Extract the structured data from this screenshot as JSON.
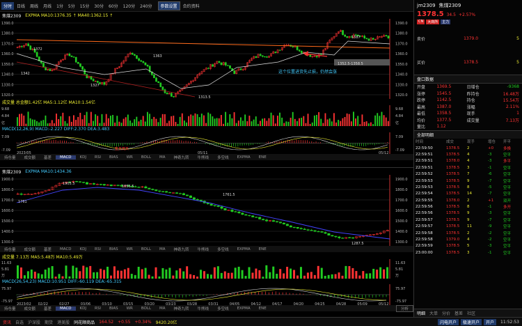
{
  "toolbar": {
    "items": [
      "分时",
      "日线",
      "周线",
      "月线",
      "1分",
      "5分",
      "15分",
      "30分",
      "60分",
      "120分",
      "240分"
    ],
    "active_index": 0,
    "params_button": "参数设置",
    "contract_info": "合约资料"
  },
  "upper_chart": {
    "symbol": "焦煤2309",
    "indicator_line": "EXPMA MA10:1376.35 ↑ MA40:1362.15 ↑",
    "y_ticks": [
      "1390.0",
      "1380.0",
      "1370.0",
      "1360.0",
      "1350.0",
      "1340.0",
      "1330.0",
      "1320.0"
    ],
    "labels": {
      "high": "1387",
      "p1372": "1372",
      "p1363": "1363",
      "p1342": "1342",
      "p1327": "1327",
      "low": "1313.5",
      "p1352": "1352.5-1358.5"
    },
    "annotation": "这个位置进货先止损，仍然会涨",
    "volume_line": "成交量 总金额1.42亿  MA5:1.12亿  MA10:1.54亿",
    "vol_ticks": [
      "9.68",
      "4.84",
      "亿"
    ],
    "macd_line": "MACD(12,26,9)  MACD:-2.227  DIFF:2.370  DEA:3.483",
    "macd_ticks": [
      "7.09",
      "-7.09"
    ],
    "macd_mark": "金叉死叉",
    "x_labels": [
      "2023/05",
      "05/11",
      "05/12"
    ],
    "tabs": [
      "持仓量",
      "成交额",
      "基差",
      "MACD",
      "KDJ",
      "RSI",
      "BIAS",
      "WR",
      "BOLL",
      "MA",
      "神奇九转",
      "牛熊线",
      "多空线",
      "EXPMA",
      "ENE"
    ],
    "active_tab": "MACD"
  },
  "lower_chart": {
    "symbol": "焦煤2309",
    "indicator_line": "EXPMA MA10:1434.36",
    "y_ticks": [
      "1900.0",
      "1800.0",
      "1700.0",
      "1600.0",
      "1500.0",
      "1400.0",
      "1300.0"
    ],
    "labels": {
      "high": "1905.5",
      "p1856": "1856.5",
      "p1761": "1761.5",
      "p1761b": "1761",
      "low": "1287.5"
    },
    "volume_line": "成交量 7.13万  MA5:5.48万  MA10:5.49万",
    "vol_ticks": [
      "11.63",
      "5.81",
      "万"
    ],
    "macd_line": "MACD(26,54,23)  MACD:10.951  DIFF:-60.119  DEA:-65.315",
    "macd_ticks": [
      "75.97",
      "-75.97"
    ],
    "x_labels": [
      "2023/02",
      "02/22",
      "02/27",
      "03/06",
      "03/10",
      "03/15",
      "03/20",
      "03/23",
      "03/28",
      "03/31",
      "04/05",
      "04/12",
      "04/17",
      "04/20",
      "04/25",
      "04/28",
      "05/09",
      "05/12"
    ],
    "tabs": [
      "持仓量",
      "成交额",
      "基差",
      "MACD",
      "KDJ",
      "RSI",
      "BIAS",
      "WR",
      "BOLL",
      "MA",
      "神奇九转",
      "牛熊线",
      "多空线",
      "EXPMA",
      "ENE"
    ],
    "active_tab": "MACD",
    "analysis_button": "分析"
  },
  "quote": {
    "code": "jm2309",
    "name": "焦煤2309",
    "price": "1378.5",
    "change": "34.5",
    "pct": "+2.57%",
    "tags": [
      "CN",
      "大商所",
      "主力"
    ],
    "ask_label": "卖价",
    "ask_price": "1379.0",
    "ask_vol": "5",
    "bid_label": "买价",
    "bid_price": "1378.5",
    "bid_vol": "5",
    "section": "盘口数据",
    "stats": [
      {
        "k1": "开盘",
        "v1": "1369.5",
        "k2": "日增仓",
        "v2": "-9368"
      },
      {
        "k1": "涨停",
        "v1": "1545.5",
        "k2": "昨持仓",
        "v2": "16.48万"
      },
      {
        "k1": "跌停",
        "v1": "1142.5",
        "k2": "持仓",
        "v2": "15.54万"
      },
      {
        "k1": "最高",
        "v1": "1387.0",
        "k2": "涨幅",
        "v2": "2.11%"
      },
      {
        "k1": "最低",
        "v1": "1358.5",
        "k2": "现手",
        "v2": "1"
      },
      {
        "k1": "均价",
        "v1": "1377.5",
        "k2": "成交量",
        "v2": "7.13万"
      },
      {
        "k1": "量比",
        "v1": "1.12",
        "k2": "",
        "v2": ""
      }
    ],
    "trade_tabs": [
      "全部明细"
    ],
    "trade_headers": [
      "时间",
      "成交",
      "现手",
      "增仓",
      "开平"
    ],
    "trades": [
      [
        "22:59:50",
        "1378.5",
        "2",
        "+0",
        "多换"
      ],
      [
        "22:59:51",
        "1378.5",
        "4",
        "-3",
        "空平"
      ],
      [
        "22:59:51",
        "1378.0",
        "4",
        "-3",
        "多平"
      ],
      [
        "22:59:51",
        "1378.5",
        "3",
        "-1",
        "空平"
      ],
      [
        "22:59:52",
        "1378.5",
        "7",
        "-6",
        "空平"
      ],
      [
        "22:59:53",
        "1378.5",
        "9",
        "-7",
        "空平"
      ],
      [
        "22:59:53",
        "1378.5",
        "8",
        "-5",
        "空平"
      ],
      [
        "22:59:54",
        "1378.5",
        "14",
        "-7",
        "空平"
      ],
      [
        "22:59:55",
        "1378.0",
        "2",
        "+1",
        "双开"
      ],
      [
        "22:59:56",
        "1378.5",
        "8",
        "-1",
        "多开"
      ],
      [
        "22:59:56",
        "1378.5",
        "9",
        "-3",
        "空平"
      ],
      [
        "22:59:57",
        "1378.5",
        "9",
        "-7",
        "空平"
      ],
      [
        "22:59:57",
        "1378.5",
        "11",
        "-9",
        "空平"
      ],
      [
        "22:59:58",
        "1378.5",
        "2",
        "-2",
        "空平"
      ],
      [
        "22:59:58",
        "1379.0",
        "4",
        "-2",
        "空平"
      ],
      [
        "22:59:59",
        "1378.5",
        "5",
        "-3",
        "空平"
      ],
      [
        "23:00:00",
        "1378.5",
        "3",
        "-1",
        "空平"
      ]
    ],
    "bottom_tabs": [
      "明细",
      "大单",
      "分价",
      "基差",
      "社区"
    ],
    "order_buttons": [
      "闪电开户",
      "极速开户",
      "开户"
    ]
  },
  "statusbar": {
    "items": [
      "资讯",
      "自选",
      "沪深股",
      "期货",
      "港美股"
    ],
    "index_name": "同花顺商品",
    "index_value": "164.52",
    "index_change": "+0.55",
    "index_pct": "+0.34%",
    "index_amount": "9420.20亿",
    "time": "11:52:53"
  },
  "colors": {
    "up": "#ff3333",
    "down": "#22cc22",
    "accent": "#2c3b70"
  }
}
